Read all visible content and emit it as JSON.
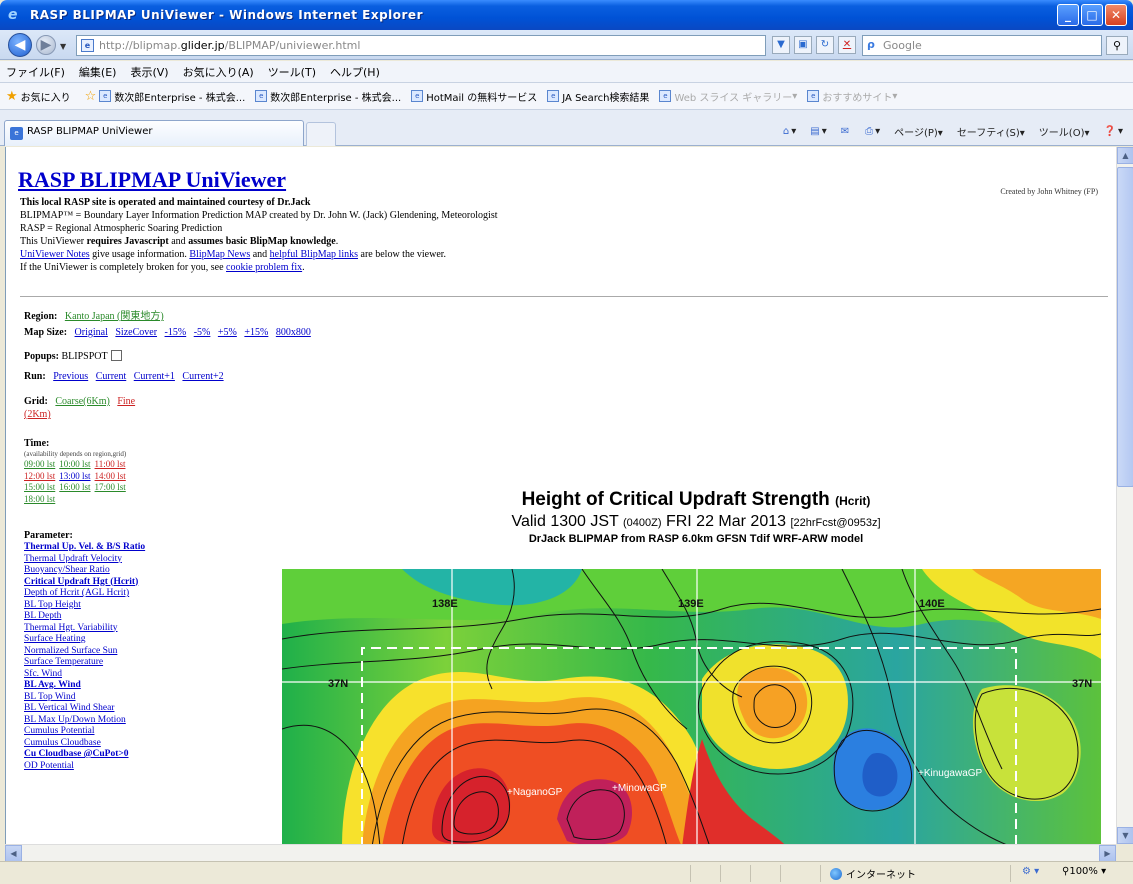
{
  "window": {
    "title": "RASP BLIPMAP UniViewer - Windows Internet Explorer"
  },
  "address_bar": {
    "url_prefix": "http://blipmap.",
    "url_host": "glider.jp",
    "url_suffix": "/BLIPMAP/univiewer.html",
    "search_placeholder": "Google"
  },
  "menu": [
    "ファイル(F)",
    "編集(E)",
    "表示(V)",
    "お気に入り(A)",
    "ツール(T)",
    "ヘルプ(H)"
  ],
  "favorites": {
    "label": "お気に入り",
    "items": [
      {
        "label": "数次郎Enterprise - 株式会..."
      },
      {
        "label": "数次郎Enterprise - 株式会..."
      },
      {
        "label": "HotMail の無料サービス"
      },
      {
        "label": "JA Search検索結果"
      },
      {
        "label": "Web スライス ギャラリー"
      },
      {
        "label": "おすすめサイト"
      }
    ]
  },
  "tab": {
    "label": "RASP BLIPMAP UniViewer"
  },
  "command_bar": [
    "ページ(P)",
    "セーフティ(S)",
    "ツール(O)"
  ],
  "page": {
    "title": "RASP BLIPMAP UniViewer",
    "credit": "Created by John Whitney (FP)",
    "intro": [
      {
        "bold": "This local RASP site is operated and maintained courtesy of Dr.Jack",
        "text": ""
      },
      {
        "bold": "",
        "text": "BLIPMAP™ = Boundary Layer Information Prediction MAP created by Dr. John W. (Jack) Glendening, Meteorologist"
      },
      {
        "bold": "",
        "text": "RASP = Regional Atmospheric Soaring Prediction"
      },
      {
        "prefix": "This UniViewer ",
        "bold": "requires Javascript",
        "mid": " and ",
        "bold2": "assumes basic BlipMap knowledge",
        "suffix": "."
      },
      {
        "link1": "UniViewer Notes",
        "t1": " give usage information.  ",
        "link2": "BlipMap News",
        "t2": " and ",
        "link3": "helpful BlipMap links",
        "t3": " are below the viewer."
      },
      {
        "text": "If the UniViewer is completely broken for you, see ",
        "link": "cookie problem fix",
        "suffix": "."
      }
    ],
    "region_label": "Region:",
    "region_value": "Kanto Japan (関東地方)",
    "mapsize_label": "Map Size:",
    "mapsize_options": [
      "Original",
      "SizeCover",
      "-15%",
      "-5%",
      "+5%",
      "+15%",
      "800x800"
    ],
    "popups_label": "Popups:",
    "popups_value": "BLIPSPOT",
    "run_label": "Run:",
    "run_options": [
      "Previous",
      "Current",
      "Current+1",
      "Current+2"
    ],
    "grid_label": "Grid:",
    "grid_options": [
      "Coarse(6Km)",
      "Fine",
      "(2Km)"
    ],
    "time_label": "Time:",
    "time_note": "(availability depends on region,grid)",
    "times": [
      [
        "09:00 lst",
        "10:00 lst",
        "11:00 lst"
      ],
      [
        "12:00 lst",
        "13:00 lst",
        "14:00 lst"
      ],
      [
        "15:00 lst",
        "16:00 lst",
        "17:00 lst"
      ],
      [
        "18:00 lst"
      ]
    ],
    "parameter_label": "Parameter:",
    "parameters": [
      {
        "label": "Thermal Up. Vel. & B/S Ratio",
        "bold": true
      },
      {
        "label": "Thermal Updraft Velocity",
        "bold": false
      },
      {
        "label": "Buoyancy/Shear Ratio",
        "bold": false
      },
      {
        "label": "Critical Updraft Hgt (Hcrit)",
        "bold": true
      },
      {
        "label": "Depth of Hcrit (AGL Hcrit)",
        "bold": false
      },
      {
        "label": "BL Top Height",
        "bold": false
      },
      {
        "label": "BL Depth",
        "bold": false
      },
      {
        "label": "Thermal Hgt. Variability",
        "bold": false
      },
      {
        "label": "Surface Heating",
        "bold": false
      },
      {
        "label": "Normalized Surface Sun",
        "bold": false
      },
      {
        "label": "Surface Temperature",
        "bold": false
      },
      {
        "label": "Sfc. Wind",
        "bold": false
      },
      {
        "label": "BL Avg. Wind",
        "bold": true
      },
      {
        "label": "BL Top Wind",
        "bold": false
      },
      {
        "label": "BL Vertical Wind Shear",
        "bold": false
      },
      {
        "label": "BL Max Up/Down Motion",
        "bold": false
      },
      {
        "label": "Cumulus Potential",
        "bold": false
      },
      {
        "label": "Cumulus Cloudbase",
        "bold": false
      },
      {
        "label": "Cu Cloudbase @CuPot>0",
        "bold": true
      },
      {
        "label": "OD Potential",
        "bold": false
      }
    ]
  },
  "chart": {
    "title": "Height of Critical Updraft Strength",
    "title_small": "(Hcrit)",
    "valid": "Valid 1300 JST",
    "valid_z": "(0400Z)",
    "valid_date": "FRI 22 Mar 2013",
    "valid_fcst": "[22hrFcst@0953z]",
    "model": "DrJack BLIPMAP from RASP 6.0km GFSN Tdif WRF-ARW model",
    "labels": {
      "lon138": "138E",
      "lon139": "139E",
      "lon140": "140E",
      "lat37_left": "37N",
      "lat37_right": "37N",
      "site1": "+NaganoGP",
      "site2": "+MinowaGP",
      "site3": "+KinugawaGP"
    }
  },
  "status": {
    "zone": "インターネット",
    "zoom": "100%"
  }
}
